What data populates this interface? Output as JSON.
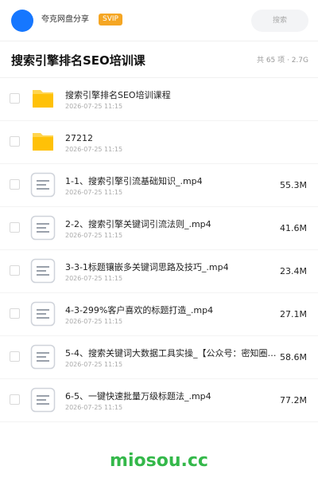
{
  "header": {
    "app_name": "夸克网盘分享",
    "badge": "SVIP",
    "search_placeholder": "搜索",
    "avatar_color": "#1677ff"
  },
  "folder": {
    "title": "搜索引擎排名SEO培训课",
    "meta": "共 65 项 · 2.7G"
  },
  "files": [
    {
      "type": "folder",
      "icon": "folder-icon",
      "name": "搜索引擎排名SEO培训课程",
      "date": "2026-07-25 11:15",
      "size": ""
    },
    {
      "type": "folder",
      "icon": "folder-icon",
      "name": "27212",
      "date": "2026-07-25 11:15",
      "size": ""
    },
    {
      "type": "file",
      "icon": "document-icon",
      "name": "1-1、搜索引擎引流基础知识_.mp4",
      "date": "2026-07-25 11:15",
      "size": "55.3M"
    },
    {
      "type": "file",
      "icon": "document-icon",
      "name": "2-2、搜索引擎关键词引流法则_.mp4",
      "date": "2026-07-25 11:15",
      "size": "41.6M"
    },
    {
      "type": "file",
      "icon": "document-icon",
      "name": "3-3-1标题镶嵌多关键词思路及技巧_.mp4",
      "date": "2026-07-25 11:15",
      "size": "23.4M"
    },
    {
      "type": "file",
      "icon": "document-icon",
      "name": "4-3-299%客户喜欢的标题打造_.mp4",
      "date": "2026-07-25 11:15",
      "size": "27.1M"
    },
    {
      "type": "file",
      "icon": "document-icon",
      "name": "5-4、搜索关键词大数据工具实操_【公众号：密知圈…",
      "date": "2026-07-25 11:15",
      "size": "58.6M"
    },
    {
      "type": "file",
      "icon": "document-icon",
      "name": "6-5、一键快速批量万级标题法_.mp4",
      "date": "2026-07-25 11:15",
      "size": "77.2M"
    }
  ],
  "watermark": "miosou.cc",
  "colors": {
    "folder": "#ffc107",
    "folder_tab": "#ffd54f",
    "watermark": "#34b84a",
    "badge": "#f5a623"
  }
}
